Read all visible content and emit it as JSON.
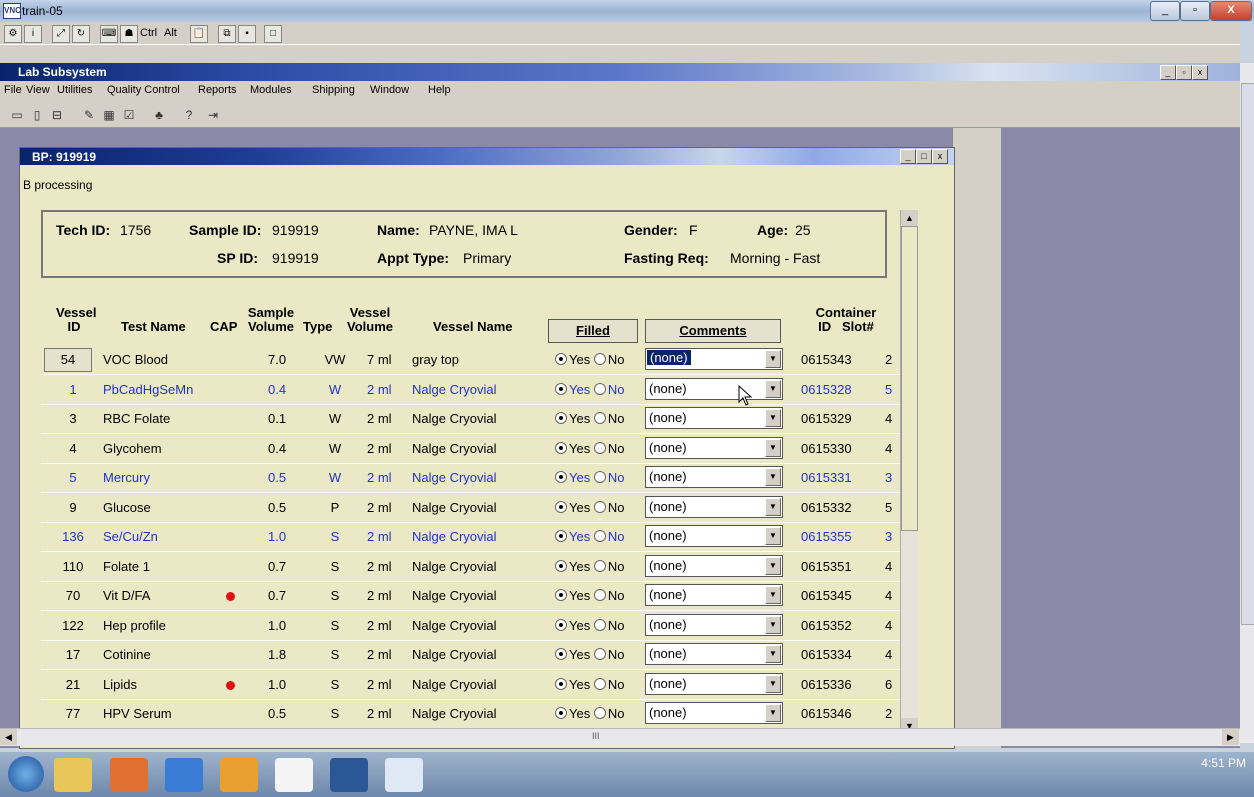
{
  "outer_window": {
    "title": "train-05"
  },
  "inner_window": {
    "title": "Lab Subsystem"
  },
  "menu": [
    "File",
    "View",
    "Utilities",
    "Quality Control",
    "Reports",
    "Modules",
    "Shipping",
    "Window",
    "Help"
  ],
  "toolbar1": {
    "ctrl_label": "Ctrl",
    "alt_label": "Alt"
  },
  "child_window": {
    "title": "BP: 919919",
    "subtitle": "B processing"
  },
  "header": {
    "tech_id_label": "Tech ID:",
    "tech_id": "1756",
    "sample_id_label": "Sample ID:",
    "sample_id": "919919",
    "name_label": "Name:",
    "name": "PAYNE, IMA L",
    "gender_label": "Gender:",
    "gender": "F",
    "age_label": "Age:",
    "age": "25",
    "sp_id_label": "SP ID:",
    "sp_id": "919919",
    "appt_type_label": "Appt Type:",
    "appt_type": "Primary",
    "fasting_label": "Fasting Req:",
    "fasting": "Morning - Fast"
  },
  "columns": {
    "vessel_id_1": "Vessel",
    "vessel_id_2": "ID",
    "test_name": "Test Name",
    "cap": "CAP",
    "sample_volume_1": "Sample",
    "sample_volume_2": "Volume",
    "type": "Type",
    "vessel_volume_1": "Vessel",
    "vessel_volume_2": "Volume",
    "vessel_name": "Vessel Name",
    "filled": "Filled",
    "comments": "Comments",
    "container_1": "Container",
    "container_id": "ID",
    "container_slot": "Slot#"
  },
  "radio": {
    "yes": "Yes",
    "no": "No"
  },
  "rows": [
    {
      "id": "54",
      "test": "VOC Blood",
      "cap": false,
      "sample_vol": "7.0",
      "type": "VW",
      "vessel_vol": "7 ml",
      "vessel": "gray top",
      "comment": "(none)",
      "container": "0615343",
      "slot": "2",
      "blue": false
    },
    {
      "id": "1",
      "test": "PbCadHgSeMn",
      "cap": false,
      "sample_vol": "0.4",
      "type": "W",
      "vessel_vol": "2 ml",
      "vessel": "Nalge Cryovial",
      "comment": "(none)",
      "container": "0615328",
      "slot": "5",
      "blue": true
    },
    {
      "id": "3",
      "test": "RBC Folate",
      "cap": false,
      "sample_vol": "0.1",
      "type": "W",
      "vessel_vol": "2 ml",
      "vessel": "Nalge Cryovial",
      "comment": "(none)",
      "container": "0615329",
      "slot": "4",
      "blue": false
    },
    {
      "id": "4",
      "test": "Glycohem",
      "cap": false,
      "sample_vol": "0.4",
      "type": "W",
      "vessel_vol": "2 ml",
      "vessel": "Nalge Cryovial",
      "comment": "(none)",
      "container": "0615330",
      "slot": "4",
      "blue": false
    },
    {
      "id": "5",
      "test": "Mercury",
      "cap": false,
      "sample_vol": "0.5",
      "type": "W",
      "vessel_vol": "2 ml",
      "vessel": "Nalge Cryovial",
      "comment": "(none)",
      "container": "0615331",
      "slot": "3",
      "blue": true
    },
    {
      "id": "9",
      "test": "Glucose",
      "cap": false,
      "sample_vol": "0.5",
      "type": "P",
      "vessel_vol": "2 ml",
      "vessel": "Nalge Cryovial",
      "comment": "(none)",
      "container": "0615332",
      "slot": "5",
      "blue": false
    },
    {
      "id": "136",
      "test": "Se/Cu/Zn",
      "cap": false,
      "sample_vol": "1.0",
      "type": "S",
      "vessel_vol": "2 ml",
      "vessel": "Nalge Cryovial",
      "comment": "(none)",
      "container": "0615355",
      "slot": "3",
      "blue": true
    },
    {
      "id": "110",
      "test": "Folate 1",
      "cap": false,
      "sample_vol": "0.7",
      "type": "S",
      "vessel_vol": "2 ml",
      "vessel": "Nalge Cryovial",
      "comment": "(none)",
      "container": "0615351",
      "slot": "4",
      "blue": false
    },
    {
      "id": "70",
      "test": "Vit D/FA",
      "cap": true,
      "sample_vol": "0.7",
      "type": "S",
      "vessel_vol": "2 ml",
      "vessel": "Nalge Cryovial",
      "comment": "(none)",
      "container": "0615345",
      "slot": "4",
      "blue": false
    },
    {
      "id": "122",
      "test": "Hep profile",
      "cap": false,
      "sample_vol": "1.0",
      "type": "S",
      "vessel_vol": "2 ml",
      "vessel": "Nalge Cryovial",
      "comment": "(none)",
      "container": "0615352",
      "slot": "4",
      "blue": false
    },
    {
      "id": "17",
      "test": "Cotinine",
      "cap": false,
      "sample_vol": "1.8",
      "type": "S",
      "vessel_vol": "2 ml",
      "vessel": "Nalge Cryovial",
      "comment": "(none)",
      "container": "0615334",
      "slot": "4",
      "blue": false
    },
    {
      "id": "21",
      "test": "Lipids",
      "cap": true,
      "sample_vol": "1.0",
      "type": "S",
      "vessel_vol": "2 ml",
      "vessel": "Nalge Cryovial",
      "comment": "(none)",
      "container": "0615336",
      "slot": "6",
      "blue": false
    },
    {
      "id": "77",
      "test": "HPV Serum",
      "cap": false,
      "sample_vol": "0.5",
      "type": "S",
      "vessel_vol": "2 ml",
      "vessel": "Nalge Cryovial",
      "comment": "(none)",
      "container": "0615346",
      "slot": "2",
      "blue": false
    }
  ],
  "taskbar": {
    "clock": "4:51 PM"
  },
  "hscroll_grip": "III",
  "colors": {
    "row_blue": "#2233cc",
    "cap_dot": "#e01010",
    "window_bg": "#ebe8c5"
  }
}
